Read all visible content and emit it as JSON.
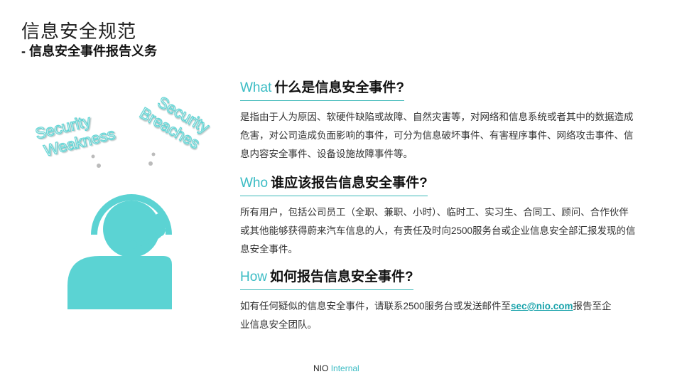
{
  "page": {
    "title": "信息安全规范",
    "subtitle": "- 信息安全事件报告义务"
  },
  "illustration": {
    "bubble_left": [
      "Security",
      "Weakness"
    ],
    "bubble_right": [
      "Security",
      "Breaches"
    ],
    "accent_color": "#5bd3d3",
    "icon": "support-agent-headset-icon"
  },
  "sections": {
    "what": {
      "keyword": "What",
      "question": "什么是信息安全事件?",
      "body": "是指由于人为原因、软硬件缺陷或故障、自然灾害等，对网络和信息系统或者其中的数据造成危害，对公司造成负面影响的事件，可分为信息破坏事件、有害程序事件、网络攻击事件、信息内容安全事件、设备设施故障事件等。"
    },
    "who": {
      "keyword": "Who",
      "question": "谁应该报告信息安全事件?",
      "body": "所有用户，包括公司员工（全职、兼职、小时）、临时工、实习生、合同工、顾问、合作伙伴或其他能够获得蔚来汽车信息的人，有责任及时向2500服务台或企业信息安全部汇报发现的信息安全事件。"
    },
    "how": {
      "keyword": "How",
      "question": "如何报告信息安全事件?",
      "body_before": "如有任何疑似的信息安全事件，请联系2500服务台或发送邮件至",
      "email": "sec@nio.com",
      "body_after": "报告至企业信息安全团队。"
    }
  },
  "footer": {
    "brand": "NIO",
    "label": "Internal"
  },
  "colors": {
    "accent": "#3bbcc4",
    "underline": "#3bb8b8"
  }
}
